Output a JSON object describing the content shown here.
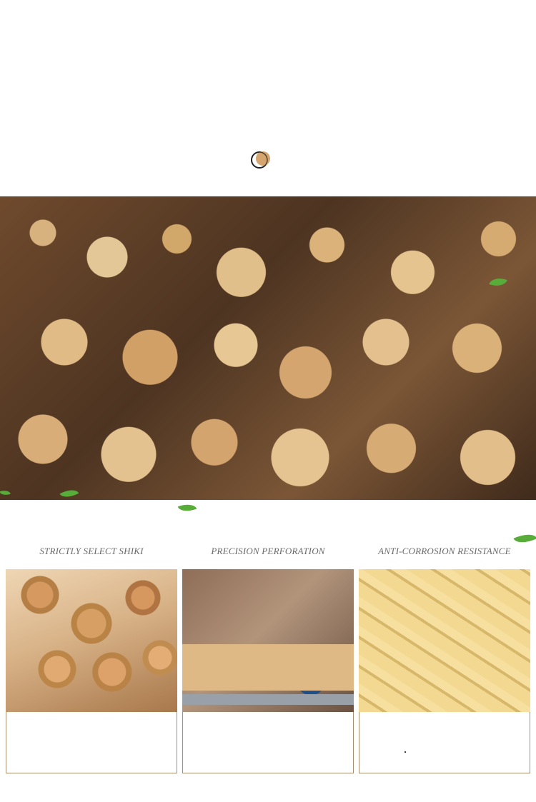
{
  "banner": {
    "alt": "stacked logs"
  },
  "features": [
    {
      "caption": "STRICTLY SELECT SHIKI"
    },
    {
      "caption": "PRECISION PERFORATION"
    },
    {
      "caption": "ANTI-CORROSION RESISTANCE"
    }
  ],
  "icons": {
    "ring": "ring-icon",
    "leaf": "leaf-icon"
  },
  "colors": {
    "frame_border": "#a98f72",
    "caption_text": "#6b6b6b"
  }
}
